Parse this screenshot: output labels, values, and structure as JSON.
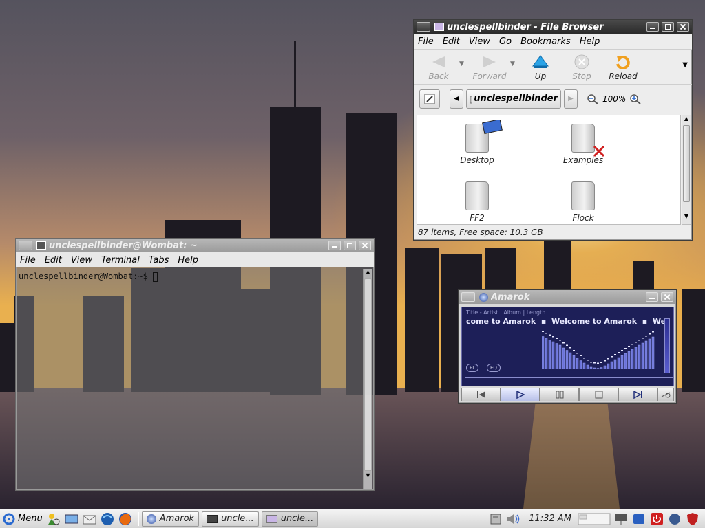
{
  "colors": {
    "sunset_top": "#5b5b68",
    "sunset_glow": "#f0a43a",
    "water": "#3b3340",
    "amarok_screen": "#1d1f58"
  },
  "file_browser": {
    "title": "unclespellbinder - File Browser",
    "menu": [
      "File",
      "Edit",
      "View",
      "Go",
      "Bookmarks",
      "Help"
    ],
    "toolbar": {
      "back": "Back",
      "forward": "Forward",
      "up": "Up",
      "stop": "Stop",
      "reload": "Reload"
    },
    "location": "unclespellbinder",
    "zoom": "100%",
    "items": [
      "Desktop",
      "Examples",
      "FF2",
      "Flock"
    ],
    "status": "87 items, Free space: 10.3 GB"
  },
  "terminal": {
    "title": "unclespellbinder@Wombat: ~",
    "menu": [
      "File",
      "Edit",
      "View",
      "Terminal",
      "Tabs",
      "Help"
    ],
    "prompt": "unclespellbinder@Wombat:~$ "
  },
  "amarok": {
    "title": "Amarok",
    "header": "Title - Artist | Album | Length",
    "marquee": "come to Amarok  ▪  Welcome to Amarok  ▪  Welco",
    "pl": "PL",
    "eq": "EQ",
    "bars": [
      0.95,
      0.9,
      0.85,
      0.8,
      0.75,
      0.7,
      0.62,
      0.55,
      0.48,
      0.4,
      0.32,
      0.25,
      0.18,
      0.12,
      0.06,
      0.04,
      0.03,
      0.05,
      0.1,
      0.16,
      0.22,
      0.28,
      0.34,
      0.4,
      0.46,
      0.52,
      0.58,
      0.64,
      0.7,
      0.76,
      0.82,
      0.88,
      0.94
    ]
  },
  "taskbar": {
    "menu": "Menu",
    "tasks": [
      "Amarok",
      "uncle...",
      "uncle..."
    ],
    "clock": "11:32 AM"
  }
}
